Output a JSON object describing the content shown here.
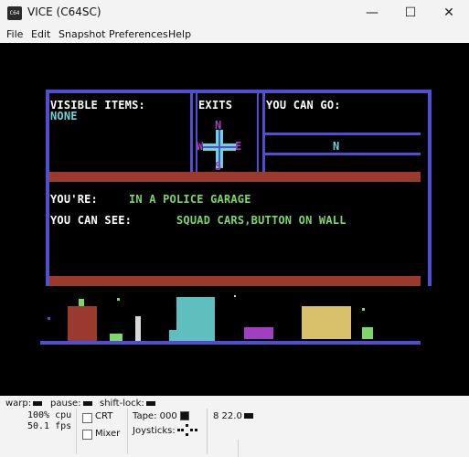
{
  "window": {
    "title": "VICE (C64SC)",
    "icon_text": "C64",
    "minimize_glyph": "—",
    "maximize_glyph": "☐",
    "close_glyph": "✕"
  },
  "menu": [
    "File",
    "Edit",
    "Snapshot",
    "Preferences",
    "Help"
  ],
  "game": {
    "visible_items_header": "VISIBLE ITEMS:",
    "visible_items_value": "NONE",
    "exits_header": "EXITS",
    "you_can_go_header": "YOU CAN GO:",
    "compass": {
      "n": "N",
      "w": "W",
      "e": "E",
      "s": "S"
    },
    "you_can_go_value": "N",
    "youre_label": "YOU'RE:",
    "youre_value": "IN A POLICE GARAGE",
    "you_can_see_label": "YOU CAN SEE:",
    "you_can_see_value": "SQUAD CARS,BUTTON ON WALL"
  },
  "status": {
    "warp_label": "warp:",
    "pause_label": "pause:",
    "shift_lock_label": "shift-lock:",
    "cpu": "100% cpu",
    "fps": "50.1 fps",
    "crt_label": "CRT",
    "mixer_label": "Mixer",
    "tape_label": "Tape:",
    "tape_counter": "000",
    "joysticks_label": "Joysticks:",
    "drive_track": "8 22.0"
  },
  "colors": {
    "c64_white": "#ffffff",
    "c64_cyan": "#6fd3d6",
    "c64_green": "#7ed66a",
    "c64_purple": "#a040c0",
    "c64_blue": "#4f4fd0",
    "c64_red": "#9a3a2e"
  }
}
